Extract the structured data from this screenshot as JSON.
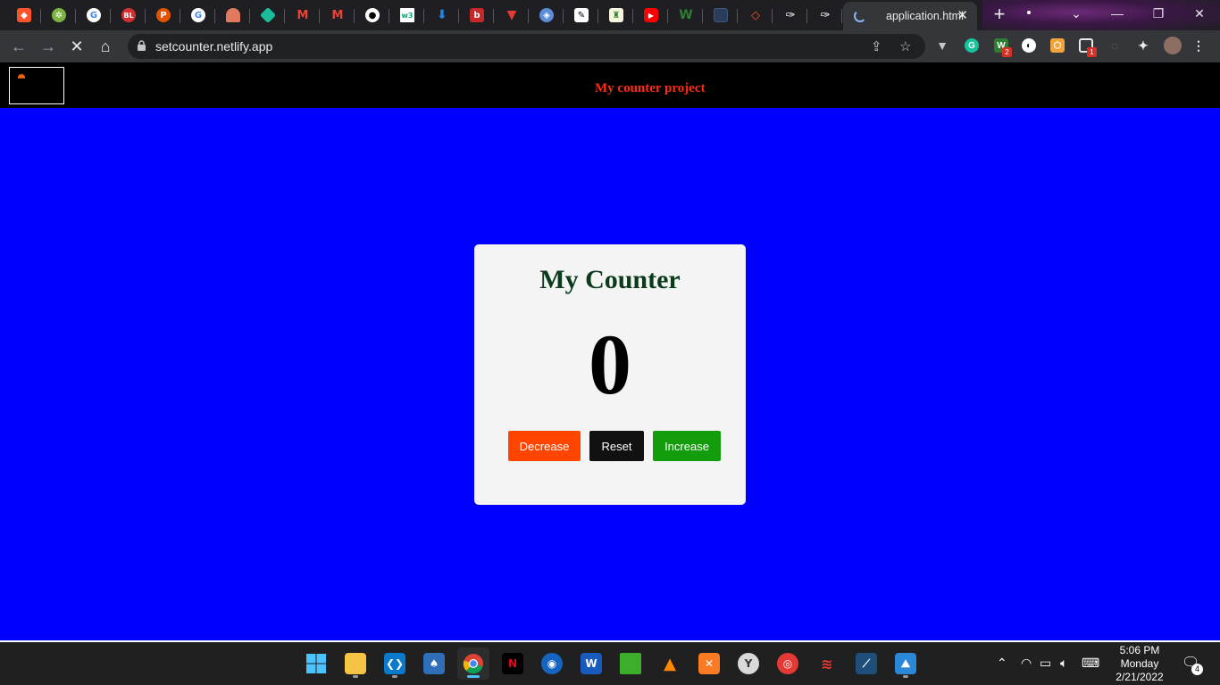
{
  "browser": {
    "active_tab_title": "application.html",
    "url": "setcounter.netlify.app",
    "pinned_tab_icons": [
      "brave-icon",
      "gear-leaf-icon",
      "google-icon",
      "bl-icon",
      "p-icon",
      "google-icon",
      "helmet-icon",
      "diamond-icon",
      "gmail-icon",
      "gmail-icon",
      "github-icon",
      "w3-icon",
      "download-icon",
      "book-icon",
      "v-icon",
      "shield-icon",
      "pen-icon",
      "ebook-icon",
      "youtube-icon",
      "w-icon",
      "doc-icon",
      "laravel-icon",
      "feather-icon",
      "feather-icon"
    ],
    "extension_badges": {
      "grammarly": "2",
      "screen": "1"
    }
  },
  "site": {
    "project_title": "My counter project"
  },
  "counter": {
    "heading": "My Counter",
    "value": "0",
    "buttons": {
      "decrease": "Decrease",
      "reset": "Reset",
      "increase": "Increase"
    }
  },
  "colors": {
    "page_bg": "#0000ff",
    "title_red": "#ff2a14",
    "decrease_bg": "#ff4500",
    "reset_bg": "#111111",
    "increase_bg": "#139c0b"
  },
  "taskbar": {
    "apps": [
      "windows-start-icon",
      "file-explorer-icon",
      "vscode-icon",
      "solitaire-icon",
      "chrome-icon",
      "netflix-icon",
      "globe-icon",
      "word-icon",
      "pipe-icon",
      "vlc-icon",
      "xampp-icon",
      "clock-app-icon",
      "owl-icon",
      "stack-icon",
      "workbench-icon",
      "photos-icon"
    ],
    "time": "5:06 PM",
    "day": "Monday",
    "date": "2/21/2022",
    "notification_count": "4"
  }
}
